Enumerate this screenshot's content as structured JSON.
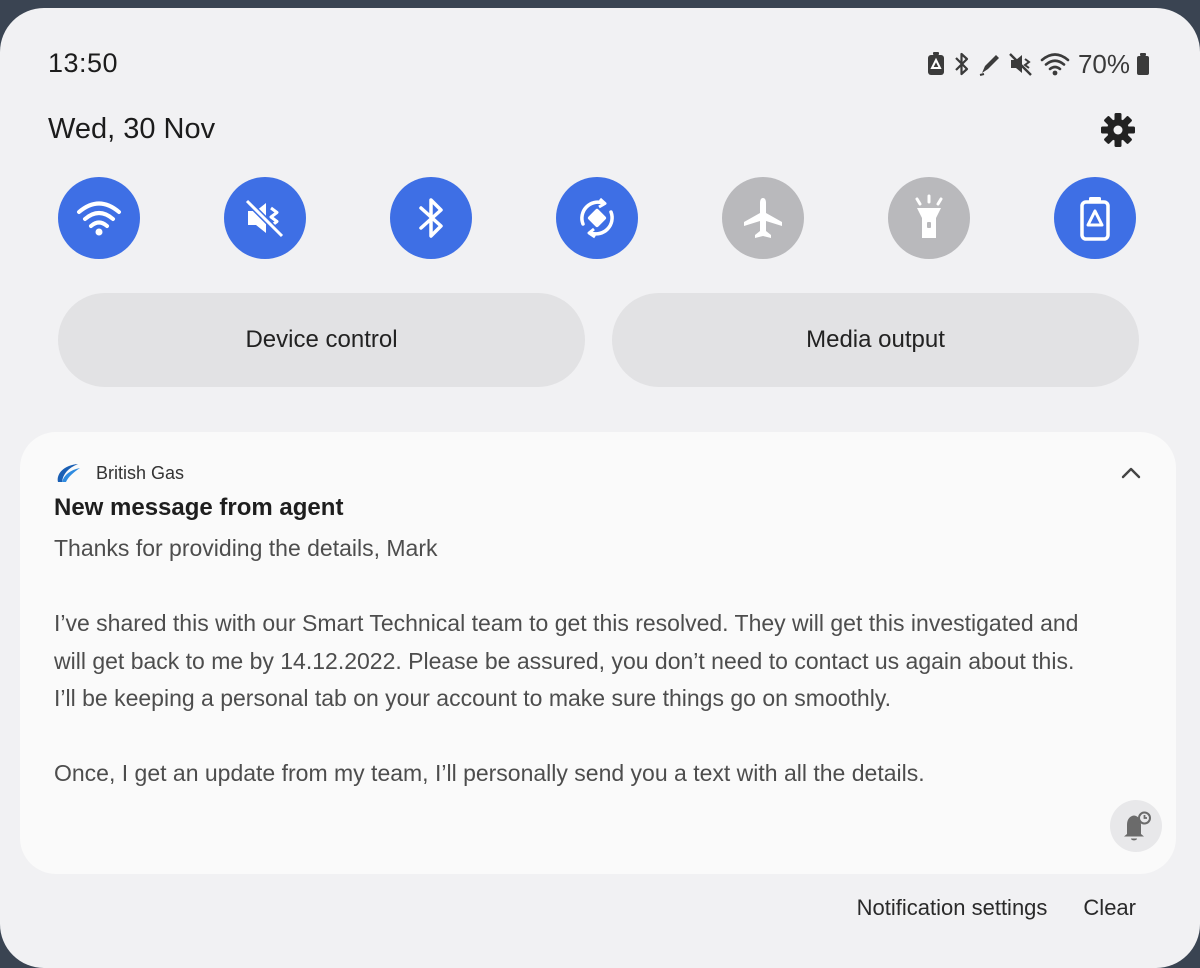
{
  "status_bar": {
    "time": "13:50",
    "battery_percent": "70%",
    "icons": [
      "battery-saver-icon",
      "bluetooth-icon",
      "pen-icon",
      "vibrate-mute-icon",
      "wifi-icon",
      "battery-icon"
    ]
  },
  "header": {
    "date": "Wed, 30 Nov",
    "settings_icon": "gear-icon"
  },
  "quick_toggles": [
    {
      "name": "wifi",
      "icon": "wifi-icon",
      "active": true
    },
    {
      "name": "sound-mode",
      "icon": "vibrate-mute-icon",
      "active": true
    },
    {
      "name": "bluetooth",
      "icon": "bluetooth-icon",
      "active": true
    },
    {
      "name": "auto-rotate",
      "icon": "auto-rotate-icon",
      "active": true
    },
    {
      "name": "airplane-mode",
      "icon": "airplane-icon",
      "active": false
    },
    {
      "name": "torch",
      "icon": "flashlight-icon",
      "active": false
    },
    {
      "name": "power-saving",
      "icon": "battery-saver-icon",
      "active": true
    }
  ],
  "buttons": {
    "device_control": "Device control",
    "media_output": "Media output"
  },
  "notification": {
    "app_name": "British Gas",
    "title": "New message from agent",
    "lines": [
      "Thanks for providing the details, Mark",
      "",
      "I’ve shared this with our Smart Technical team to get this resolved. They will get this investigated and",
      "will get back to me by 14.12.2022. Please be assured, you don’t need to contact us again about this.",
      "I’ll be keeping a personal tab on your account to make sure things go on smoothly.",
      "",
      "Once, I get an update from my team, I’ll personally send you a text with all the details."
    ]
  },
  "footer": {
    "notification_settings": "Notification settings",
    "clear": "Clear"
  },
  "colors": {
    "accent_on": "#3e6fe5",
    "toggle_off": "#b9b9bc",
    "panel_bg": "#f1f1f3",
    "card_bg": "#fafafa"
  }
}
